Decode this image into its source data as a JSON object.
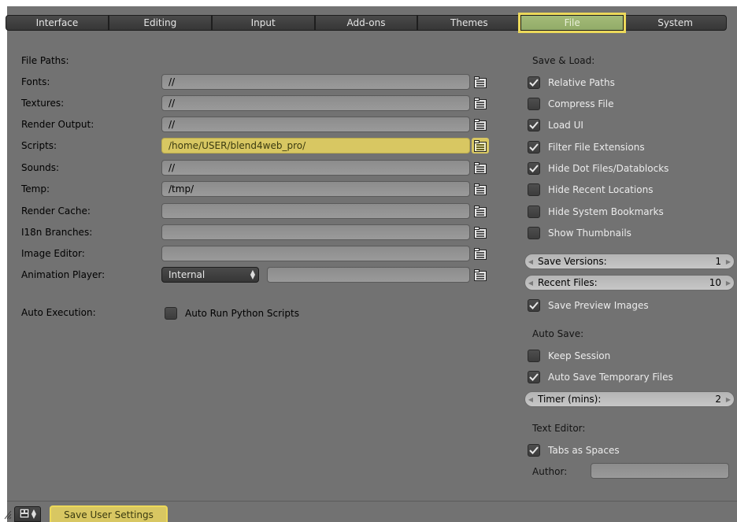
{
  "tabs": [
    {
      "label": "Interface",
      "active": false
    },
    {
      "label": "Editing",
      "active": false
    },
    {
      "label": "Input",
      "active": false
    },
    {
      "label": "Add-ons",
      "active": false
    },
    {
      "label": "Themes",
      "active": false
    },
    {
      "label": "File",
      "active": true
    },
    {
      "label": "System",
      "active": false
    }
  ],
  "file_paths": {
    "heading": "File Paths:",
    "fonts": {
      "label": "Fonts:",
      "value": "//"
    },
    "textures": {
      "label": "Textures:",
      "value": "//"
    },
    "render_output": {
      "label": "Render Output:",
      "value": "//"
    },
    "scripts": {
      "label": "Scripts:",
      "value": "/home/USER/blend4web_pro/"
    },
    "sounds": {
      "label": "Sounds:",
      "value": "//"
    },
    "temp": {
      "label": "Temp:",
      "value": "/tmp/"
    },
    "render_cache": {
      "label": "Render Cache:",
      "value": ""
    },
    "i18n_branches": {
      "label": "I18n Branches:",
      "value": ""
    },
    "image_editor": {
      "label": "Image Editor:",
      "value": ""
    },
    "animation_player": {
      "label": "Animation Player:",
      "preset": "Internal",
      "value": ""
    }
  },
  "auto_execution": {
    "label": "Auto Execution:",
    "auto_run_python": {
      "label": "Auto Run Python Scripts",
      "checked": false
    }
  },
  "save_load": {
    "heading": "Save & Load:",
    "relative_paths": {
      "label": "Relative Paths",
      "checked": true
    },
    "compress_file": {
      "label": "Compress File",
      "checked": false
    },
    "load_ui": {
      "label": "Load UI",
      "checked": true
    },
    "filter_file_extensions": {
      "label": "Filter File Extensions",
      "checked": true
    },
    "hide_dot_files": {
      "label": "Hide Dot Files/Datablocks",
      "checked": true
    },
    "hide_recent_locations": {
      "label": "Hide Recent Locations",
      "checked": false
    },
    "hide_system_bookmarks": {
      "label": "Hide System Bookmarks",
      "checked": false
    },
    "show_thumbnails": {
      "label": "Show Thumbnails",
      "checked": false
    },
    "save_versions": {
      "label": "Save Versions:",
      "value": "1"
    },
    "recent_files": {
      "label": "Recent Files:",
      "value": "10"
    },
    "save_preview_images": {
      "label": "Save Preview Images",
      "checked": true
    }
  },
  "auto_save": {
    "heading": "Auto Save:",
    "keep_session": {
      "label": "Keep Session",
      "checked": false
    },
    "auto_save_temp": {
      "label": "Auto Save Temporary Files",
      "checked": true
    },
    "timer": {
      "label": "Timer (mins):",
      "value": "2"
    }
  },
  "text_editor": {
    "heading": "Text Editor:",
    "tabs_as_spaces": {
      "label": "Tabs as Spaces",
      "checked": true
    },
    "author": {
      "label": "Author:",
      "value": ""
    }
  },
  "footer": {
    "save_label": "Save User Settings"
  },
  "colors": {
    "panel": "#727272",
    "highlight": "#ecd95a",
    "active_tab": "#9ab470"
  }
}
